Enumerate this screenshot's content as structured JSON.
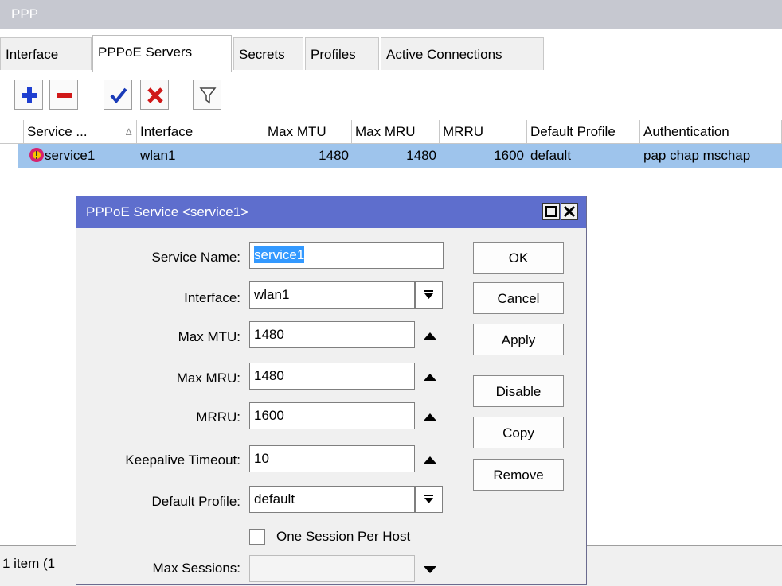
{
  "window": {
    "title": "PPP"
  },
  "tabs": [
    "Interface",
    "PPPoE Servers",
    "Secrets",
    "Profiles",
    "Active Connections"
  ],
  "toolbar": {
    "icons": [
      "plus-icon",
      "minus-icon",
      "check-icon",
      "cross-icon",
      "filter-icon"
    ]
  },
  "table": {
    "columns": [
      "Service ...",
      "Interface",
      "Max MTU",
      "Max MRU",
      "MRRU",
      "Default Profile",
      "Authentication"
    ],
    "rows": [
      {
        "service": "service1",
        "interface": "wlan1",
        "max_mtu": "1480",
        "max_mru": "1480",
        "mrru": "1600",
        "default_profile": "default",
        "authentication": "pap chap mschap"
      }
    ]
  },
  "status": {
    "text": "1 item (1"
  },
  "dialog": {
    "title": "PPPoE Service <service1>",
    "fields": {
      "service_name": {
        "label": "Service Name:",
        "value": "service1"
      },
      "interface": {
        "label": "Interface:",
        "value": "wlan1"
      },
      "max_mtu": {
        "label": "Max MTU:",
        "value": "1480"
      },
      "max_mru": {
        "label": "Max MRU:",
        "value": "1480"
      },
      "mrru": {
        "label": "MRRU:",
        "value": "1600"
      },
      "keepalive": {
        "label": "Keepalive Timeout:",
        "value": "10"
      },
      "default_profile": {
        "label": "Default Profile:",
        "value": "default"
      },
      "one_session": {
        "label": "One Session Per Host",
        "checked": false
      },
      "max_sessions": {
        "label": "Max Sessions:",
        "value": ""
      }
    },
    "buttons": {
      "ok": "OK",
      "cancel": "Cancel",
      "apply": "Apply",
      "disable": "Disable",
      "copy": "Copy",
      "remove": "Remove"
    }
  },
  "colors": {
    "accent": "#5e6ecd",
    "selection": "#9ec4ec"
  }
}
